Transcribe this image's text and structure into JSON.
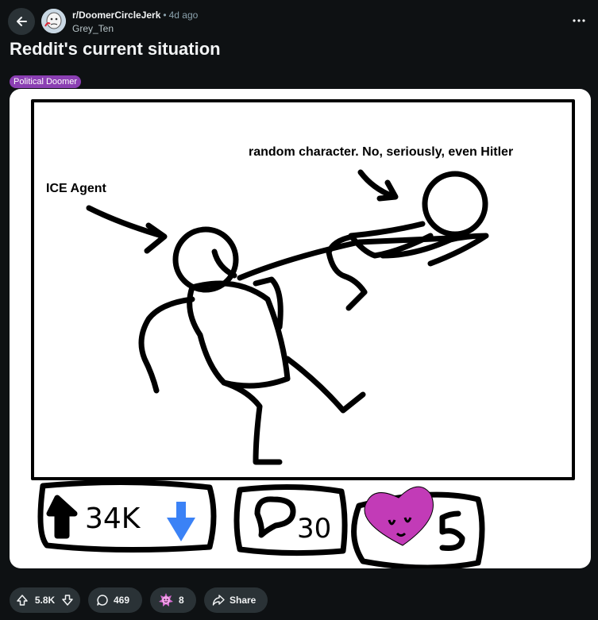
{
  "post": {
    "subreddit": "r/DoomerCircleJerk",
    "separator": "•",
    "age": "4d ago",
    "author": "Grey_Ten",
    "title": "Reddit's current situation",
    "flair": "Political Doomer"
  },
  "image": {
    "label_ice": "ICE Agent",
    "label_random": "random character. No, seriously, even Hitler",
    "drawn_votes": "34K",
    "drawn_comments": "30",
    "drawn_awards": "5"
  },
  "actions": {
    "votes": "5.8K",
    "comments": "469",
    "awards": "8",
    "share": "Share"
  },
  "icons": {
    "back": "back-arrow-icon",
    "more": "more-options-icon",
    "upvote": "upvote-icon",
    "downvote": "downvote-icon",
    "comment": "comment-icon",
    "award": "award-icon",
    "share": "share-icon"
  },
  "colors": {
    "background": "#0e1113",
    "pill": "#2a3236",
    "flair": "#8b3fb3",
    "drawn_down_arrow": "#3b82f6",
    "drawn_heart": "#c23bb7"
  }
}
